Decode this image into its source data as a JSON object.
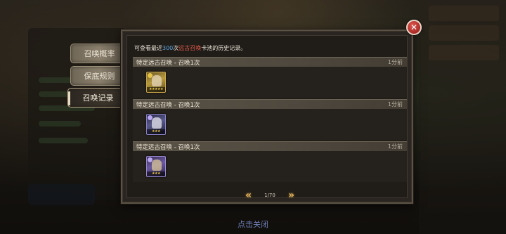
{
  "tabs": [
    {
      "label": "召唤概率",
      "active": false
    },
    {
      "label": "保底规则",
      "active": false
    },
    {
      "label": "召唤记录",
      "active": true
    }
  ],
  "intro": {
    "prefix": "可查看最近",
    "count": "300",
    "middle": "次",
    "pool_name": "远古召唤",
    "suffix": "卡池的历史记录。"
  },
  "records": [
    {
      "title": "特定远古召唤 - 召唤1次",
      "time": "1分前",
      "card_icon": "hero-card-icon",
      "stars": "★★★★★"
    },
    {
      "title": "特定远古召唤 - 召唤1次",
      "time": "1分前",
      "card_icon": "hero-card-icon",
      "stars": "★★★"
    },
    {
      "title": "特定远古召唤 - 召唤1次",
      "time": "1分前",
      "card_icon": "hero-card-icon",
      "stars": "★★★"
    }
  ],
  "pager": {
    "text": "1/70",
    "prev_icon": "double-chevron-left-icon",
    "next_icon": "double-chevron-right-icon"
  },
  "close_button": {
    "icon": "close-x-icon"
  },
  "tap_to_close": "点击关闭",
  "colors": {
    "highlight_count": "#5fa8e6",
    "highlight_pool": "#e25a4a",
    "close_button": "#c0392b",
    "pager_arrow": "#e2b45a"
  }
}
